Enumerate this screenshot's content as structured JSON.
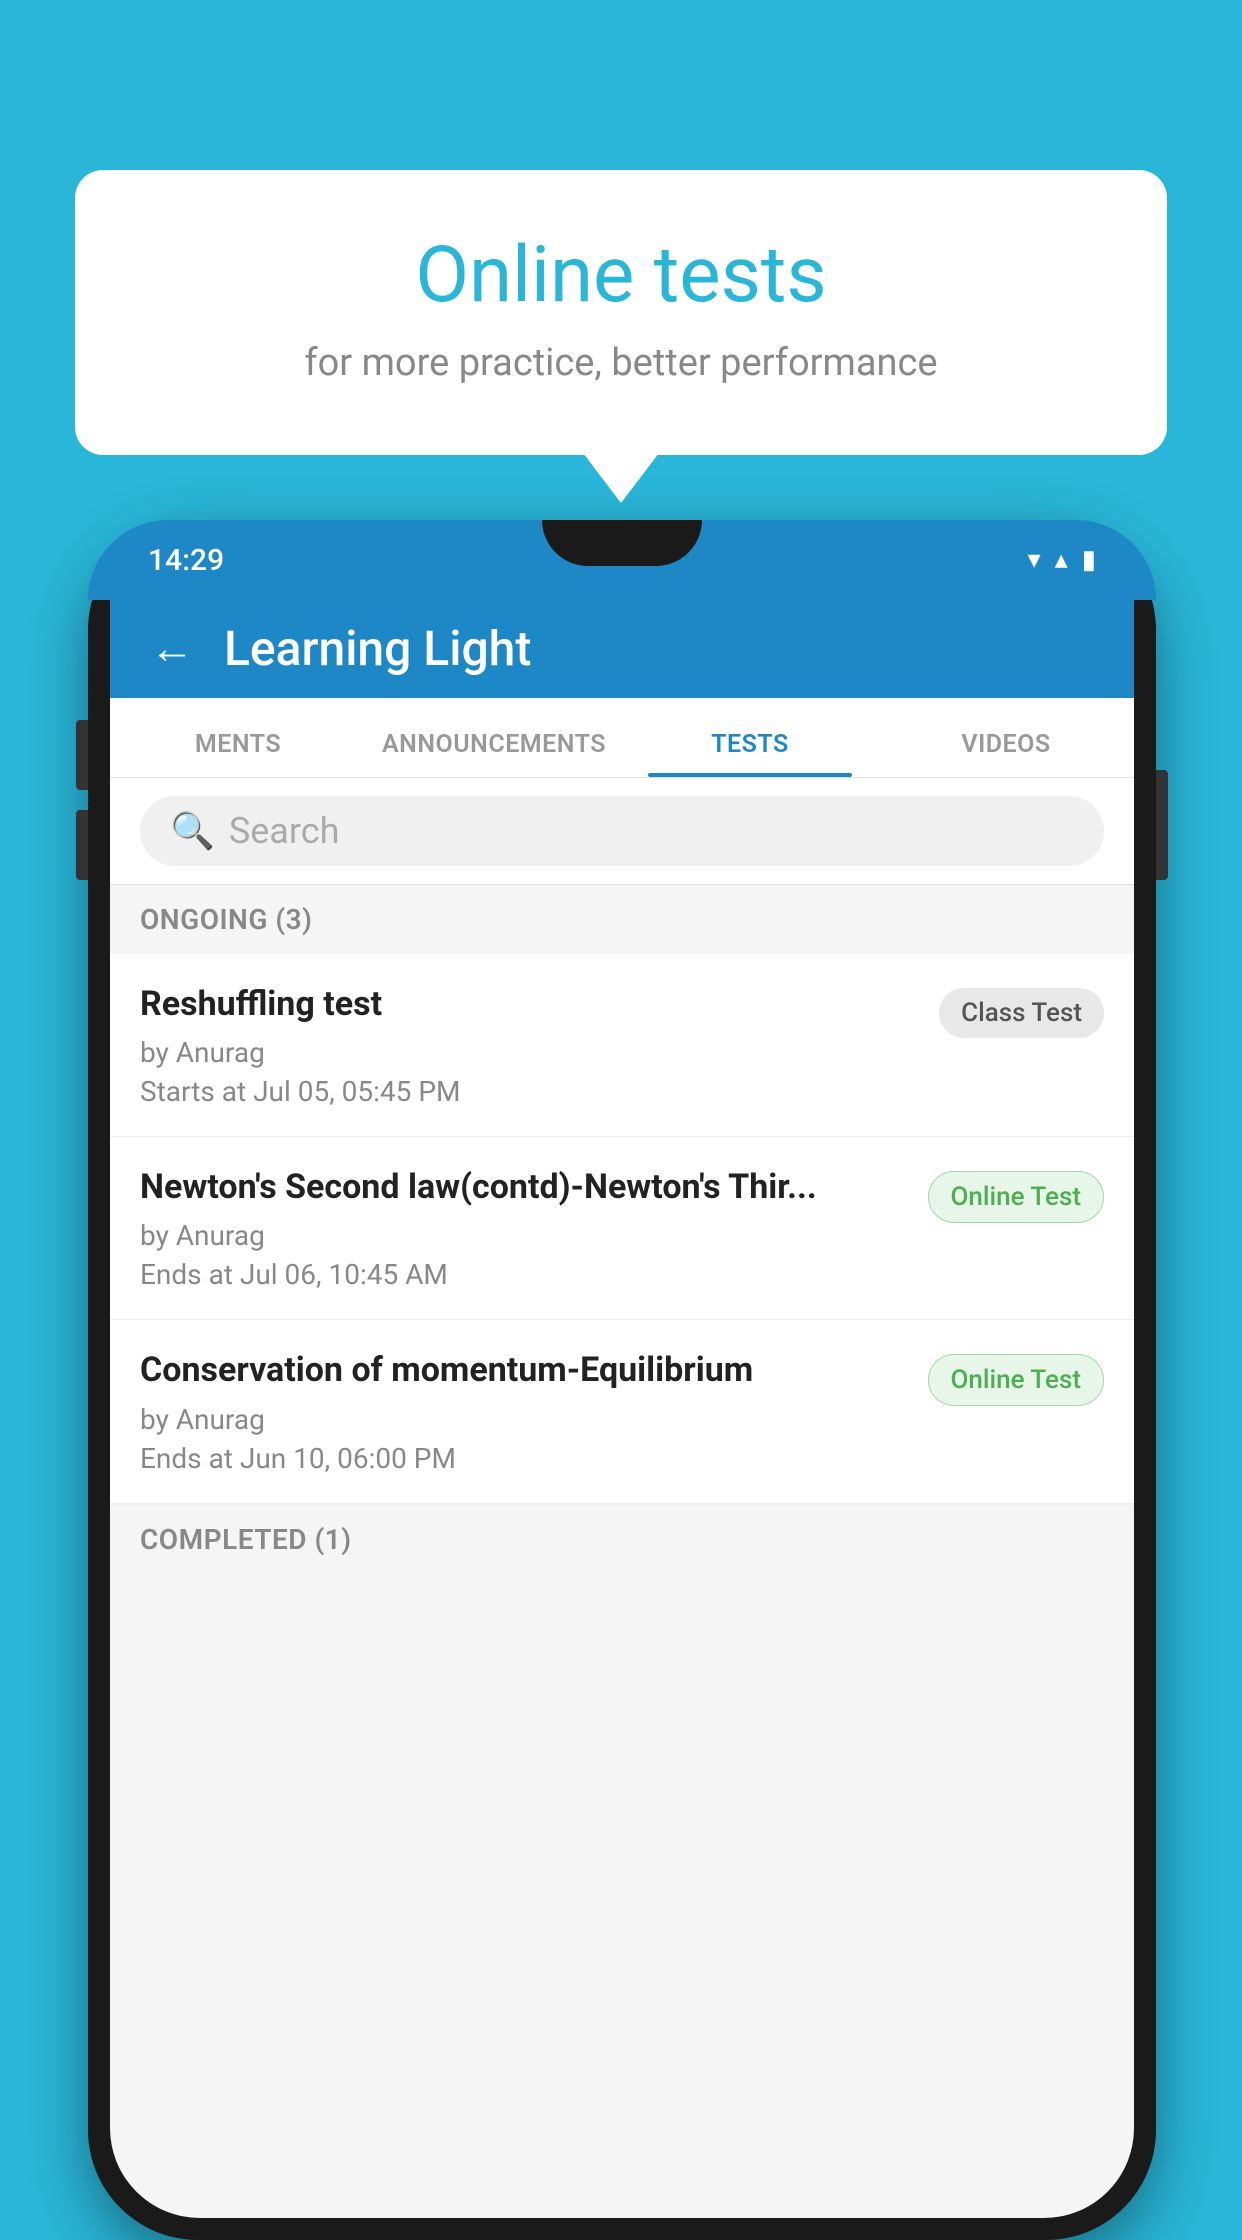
{
  "background_color": "#29b6d8",
  "promo": {
    "title": "Online tests",
    "subtitle": "for more practice, better performance"
  },
  "status_bar": {
    "time": "14:29",
    "wifi_icon": "▼",
    "signal_icon": "▲",
    "battery_icon": "▮"
  },
  "app": {
    "title": "Learning Light",
    "back_label": "←"
  },
  "tabs": [
    {
      "label": "MENTS",
      "active": false
    },
    {
      "label": "ANNOUNCEMENTS",
      "active": false
    },
    {
      "label": "TESTS",
      "active": true
    },
    {
      "label": "VIDEOS",
      "active": false
    }
  ],
  "search": {
    "placeholder": "Search"
  },
  "sections": [
    {
      "label": "ONGOING (3)",
      "items": [
        {
          "name": "Reshuffling test",
          "by": "by Anurag",
          "date": "Starts at  Jul 05, 05:45 PM",
          "badge": "Class Test",
          "badge_type": "class"
        },
        {
          "name": "Newton's Second law(contd)-Newton's Thir...",
          "by": "by Anurag",
          "date": "Ends at  Jul 06, 10:45 AM",
          "badge": "Online Test",
          "badge_type": "online"
        },
        {
          "name": "Conservation of momentum-Equilibrium",
          "by": "by Anurag",
          "date": "Ends at  Jun 10, 06:00 PM",
          "badge": "Online Test",
          "badge_type": "online"
        }
      ]
    }
  ],
  "completed_label": "COMPLETED (1)"
}
